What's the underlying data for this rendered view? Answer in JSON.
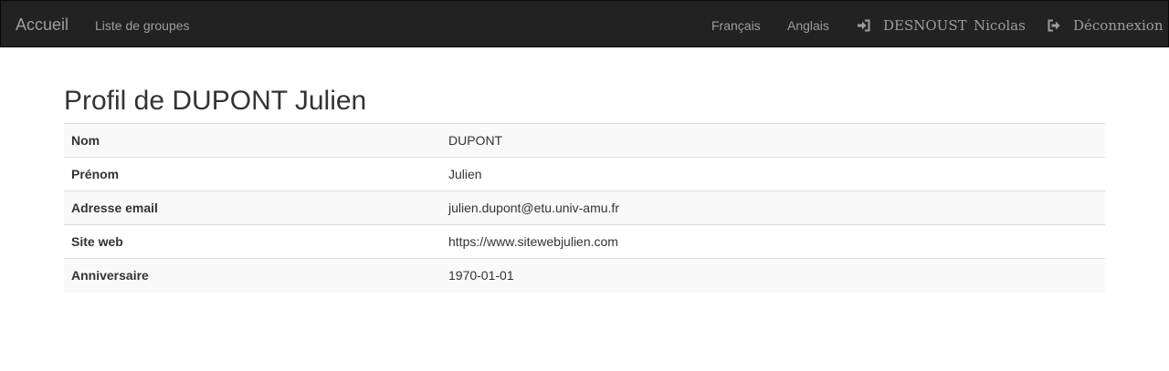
{
  "navbar": {
    "brand": "Accueil",
    "groups_link": "Liste de groupes",
    "lang_fr": "Français",
    "lang_en": "Anglais",
    "user_lastname": "DESNOUST",
    "user_firstname": "Nicolas",
    "logout": "Déconnexion",
    "icons": {
      "user": "log-in-icon",
      "logout": "log-out-icon"
    }
  },
  "page": {
    "title": "Profil de DUPONT Julien"
  },
  "profile": {
    "rows": [
      {
        "label": "Nom",
        "value": "DUPONT"
      },
      {
        "label": "Prénom",
        "value": "Julien"
      },
      {
        "label": "Adresse email",
        "value": "julien.dupont@etu.univ-amu.fr"
      },
      {
        "label": "Site web",
        "value": "https://www.sitewebjulien.com"
      },
      {
        "label": "Anniversaire",
        "value": "1970-01-01"
      }
    ]
  },
  "colors": {
    "navbar_bg": "#222222",
    "nav_text": "#9d9d9d",
    "stripe": "#f9f9f9",
    "border": "#dddddd"
  }
}
